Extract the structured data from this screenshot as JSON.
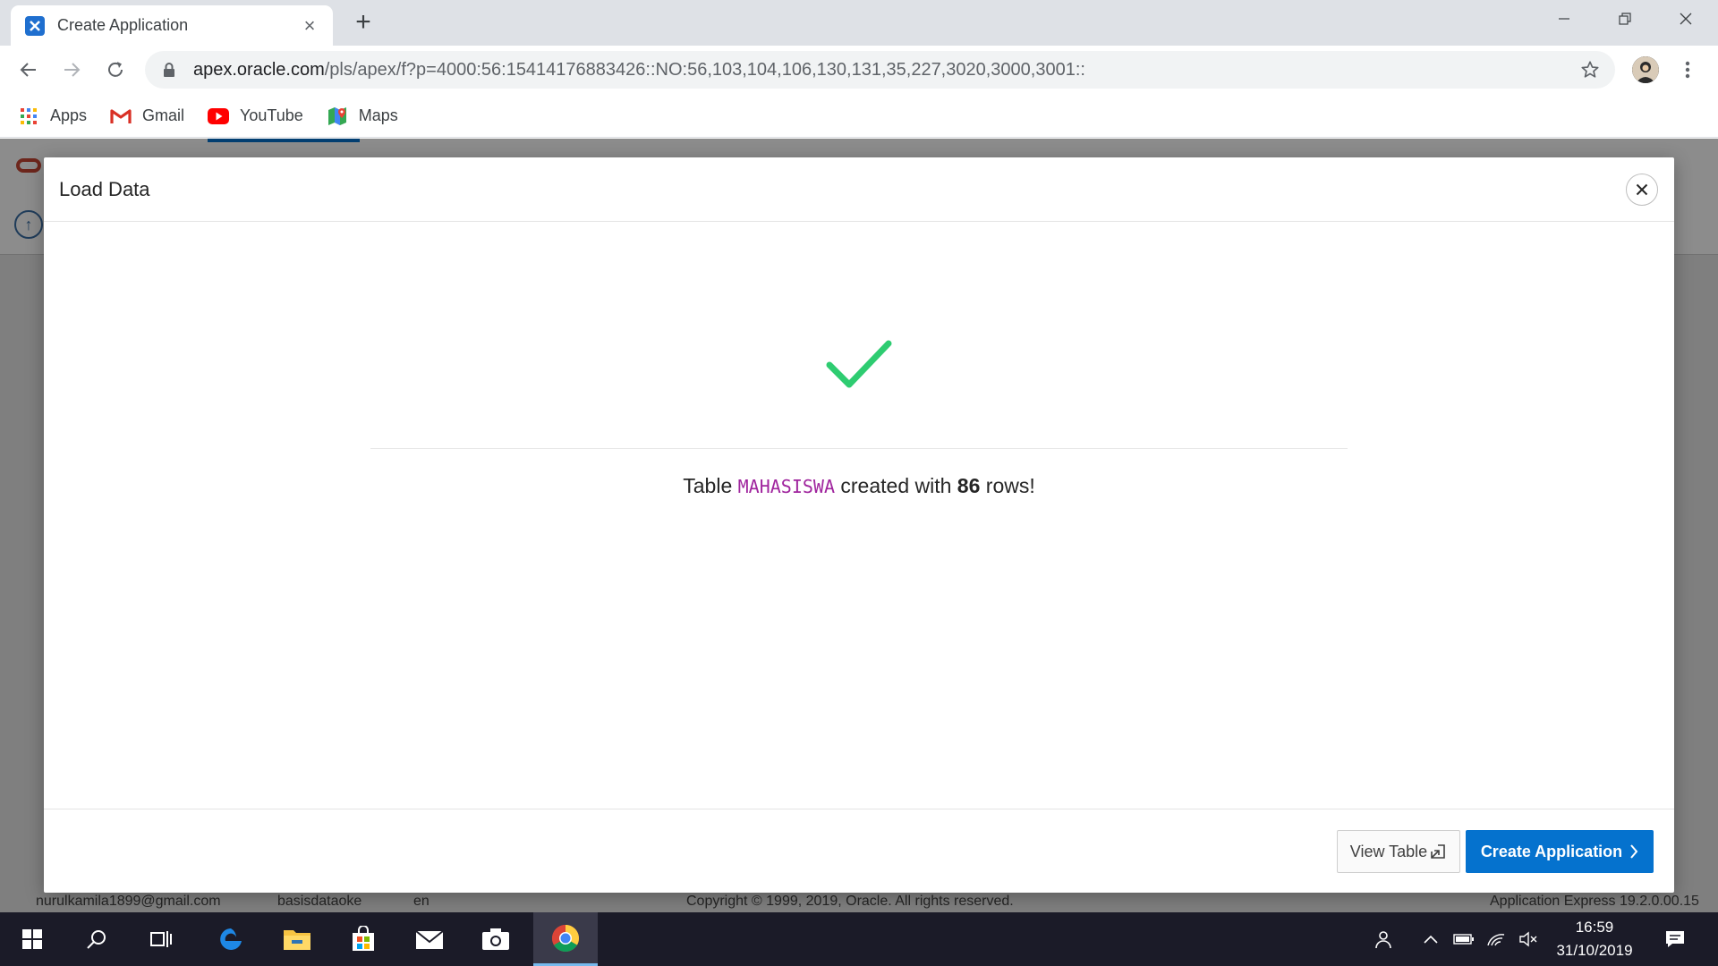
{
  "browser": {
    "tab_title": "Create Application",
    "new_tab_symbol": "+",
    "url_host": "apex.oracle.com",
    "url_path": "/pls/apex/f?p=4000:56:15414176883426::NO:56,103,104,106,130,131,35,227,3020,3000,3001::"
  },
  "bookmarks": [
    {
      "label": "Apps",
      "icon": "apps-grid-icon"
    },
    {
      "label": "Gmail",
      "icon": "gmail-icon"
    },
    {
      "label": "YouTube",
      "icon": "youtube-icon"
    },
    {
      "label": "Maps",
      "icon": "maps-icon"
    }
  ],
  "background_page": {
    "footer_user": "nurulkamila1899@gmail.com",
    "footer_workspace": "basisdataoke",
    "footer_lang": "en",
    "footer_copyright": "Copyright © 1999, 2019, Oracle. All rights reserved.",
    "footer_version": "Application Express 19.2.0.00.15"
  },
  "dialog": {
    "title": "Load Data",
    "message_prefix": "Table",
    "table_name": "MAHASISWA",
    "message_mid": "created with",
    "row_count": "86",
    "message_suffix": "rows!",
    "view_table_label": "View Table",
    "create_app_label": "Create Application"
  },
  "taskbar": {
    "time": "16:59",
    "date": "31/10/2019"
  },
  "colors": {
    "accent": "#0572ce",
    "success": "#2ecc71",
    "table_name": "#a0259e"
  }
}
